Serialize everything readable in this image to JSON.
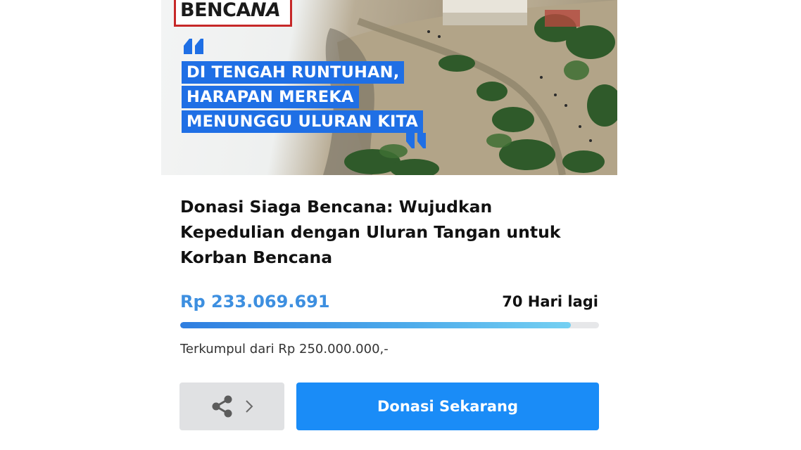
{
  "banner": {
    "brand_text_1": "BENCA",
    "brand_text_2": "NA",
    "quote_lines": [
      "DI TENGAH RUNTUHAN,",
      "HARAPAN MEREKA",
      "MENUNGGU ULURAN KITA"
    ],
    "accent_color": "#1f6fe5",
    "badge_border_color": "#c62828"
  },
  "campaign": {
    "title": "Donasi Siaga Bencana: Wujudkan Kepedulian dengan Uluran Tangan untuk Korban Bencana",
    "amount_collected": "Rp 233.069.691",
    "days_left": "70 Hari lagi",
    "target_text": "Terkumpul dari Rp 250.000.000,-",
    "progress_fraction": 0.932
  },
  "actions": {
    "share_icon": "share-icon",
    "chevron_icon": "chevron-right-icon",
    "donate_label": "Donasi Sekarang",
    "primary_color": "#1a8cf7"
  }
}
